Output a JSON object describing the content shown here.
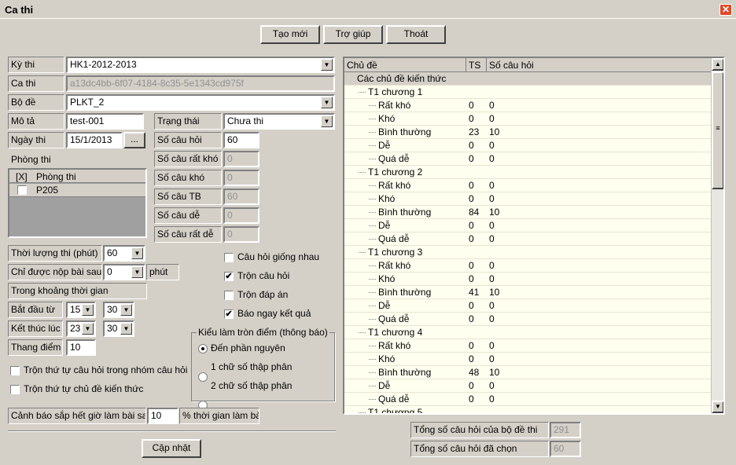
{
  "window": {
    "title": "Ca thi"
  },
  "toolbar": {
    "new_label": "Tạo mới",
    "help_label": "Trợ giúp",
    "exit_label": "Thoát"
  },
  "form": {
    "ky_thi": {
      "label": "Kỳ thi",
      "value": "HK1-2012-2013"
    },
    "ca_thi": {
      "label": "Ca thi",
      "value": "a13dc4bb-6f07-4184-8c35-5e1343cd975f"
    },
    "bo_de": {
      "label": "Bộ đề",
      "value": "PLKT_2"
    },
    "mo_ta": {
      "label": "Mô tả",
      "value": "test-001"
    },
    "trang_thai": {
      "label": "Trạng thái",
      "value": "Chưa thi"
    },
    "ngay_thi": {
      "label": "Ngày thi",
      "value": "15/1/2013",
      "picker": "..."
    },
    "so_cau_hoi": {
      "label": "Số câu hỏi",
      "value": "60"
    },
    "so_cau_rat_kho": {
      "label": "Số câu rất khó",
      "value": "0"
    },
    "so_cau_kho": {
      "label": "Số câu khó",
      "value": "0"
    },
    "so_cau_tb": {
      "label": "Số câu TB",
      "value": "60"
    },
    "so_cau_de": {
      "label": "Số câu dễ",
      "value": "0"
    },
    "so_cau_rat_de": {
      "label": "Số câu rất dễ",
      "value": "0"
    },
    "phong_thi": {
      "label": "Phòng thi",
      "col_check": "[X]",
      "col_name": "Phòng thi",
      "rooms": [
        {
          "name": "P205",
          "checked": false
        }
      ]
    },
    "thoi_luong": {
      "label": "Thời lượng thi (phút)",
      "value": "60"
    },
    "nop_bai_sau": {
      "label": "Chỉ được nộp bài sau",
      "value": "0",
      "unit": "phút"
    },
    "khoang_tg": {
      "label": "Trong khoảng thời gian"
    },
    "bat_dau": {
      "label": "Bắt đầu từ",
      "hour": "15",
      "minute": "30"
    },
    "ket_thuc": {
      "label": "Kết thúc lúc",
      "hour": "23",
      "minute": "30"
    },
    "thang_diem": {
      "label": "Thang điểm",
      "value": "10"
    },
    "tron_thu_tu_cau_hoi": {
      "label": "Trộn thứ tự câu hỏi trong nhóm câu hỏi",
      "checked": false
    },
    "tron_thu_tu_chu_de": {
      "label": "Trộn thứ tự chủ đề kiến thức",
      "checked": false
    },
    "cau_hoi_giong_nhau": {
      "label": "Câu hỏi giống nhau",
      "checked": false
    },
    "tron_cau_hoi": {
      "label": "Trộn câu hỏi",
      "checked": true
    },
    "tron_dap_an": {
      "label": "Trộn đáp án",
      "checked": false
    },
    "bao_ngay_kq": {
      "label": "Báo ngay kết quả",
      "checked": true
    },
    "lam_tron": {
      "title": "Kiểu làm tròn điểm (thông báo)",
      "options": [
        "Đến phần nguyên",
        "1 chữ số thập phân",
        "2 chữ số thập phân"
      ],
      "selected": 0
    },
    "canh_bao": {
      "label": "Cảnh báo sắp hết giờ làm bài sau",
      "value": "10",
      "unit": "% thời gian làm bài"
    },
    "update_label": "Cập nhật"
  },
  "tree": {
    "headers": [
      "Chủ đề",
      "TS",
      "Số câu hỏi"
    ],
    "rows": [
      {
        "name": "Các chủ đề kiến thức",
        "ts": "",
        "sc": "",
        "level": 0
      },
      {
        "name": "T1 chương 1",
        "ts": "",
        "sc": "",
        "level": 1
      },
      {
        "name": "Rất khó",
        "ts": "0",
        "sc": "0",
        "level": 2
      },
      {
        "name": "Khó",
        "ts": "0",
        "sc": "0",
        "level": 2
      },
      {
        "name": "Bình thường",
        "ts": "23",
        "sc": "10",
        "level": 2
      },
      {
        "name": "Dễ",
        "ts": "0",
        "sc": "0",
        "level": 2
      },
      {
        "name": "Quá dễ",
        "ts": "0",
        "sc": "0",
        "level": 2
      },
      {
        "name": "T1 chương 2",
        "ts": "",
        "sc": "",
        "level": 1
      },
      {
        "name": "Rất khó",
        "ts": "0",
        "sc": "0",
        "level": 2
      },
      {
        "name": "Khó",
        "ts": "0",
        "sc": "0",
        "level": 2
      },
      {
        "name": "Bình thường",
        "ts": "84",
        "sc": "10",
        "level": 2
      },
      {
        "name": "Dễ",
        "ts": "0",
        "sc": "0",
        "level": 2
      },
      {
        "name": "Quá dễ",
        "ts": "0",
        "sc": "0",
        "level": 2
      },
      {
        "name": "T1 chương 3",
        "ts": "",
        "sc": "",
        "level": 1
      },
      {
        "name": "Rất khó",
        "ts": "0",
        "sc": "0",
        "level": 2
      },
      {
        "name": "Khó",
        "ts": "0",
        "sc": "0",
        "level": 2
      },
      {
        "name": "Bình thường",
        "ts": "41",
        "sc": "10",
        "level": 2
      },
      {
        "name": "Dễ",
        "ts": "0",
        "sc": "0",
        "level": 2
      },
      {
        "name": "Quá dễ",
        "ts": "0",
        "sc": "0",
        "level": 2
      },
      {
        "name": "T1 chương 4",
        "ts": "",
        "sc": "",
        "level": 1
      },
      {
        "name": "Rất khó",
        "ts": "0",
        "sc": "0",
        "level": 2
      },
      {
        "name": "Khó",
        "ts": "0",
        "sc": "0",
        "level": 2
      },
      {
        "name": "Bình thường",
        "ts": "48",
        "sc": "10",
        "level": 2
      },
      {
        "name": "Dễ",
        "ts": "0",
        "sc": "0",
        "level": 2
      },
      {
        "name": "Quá dễ",
        "ts": "0",
        "sc": "0",
        "level": 2
      },
      {
        "name": "T1 chương 5",
        "ts": "",
        "sc": "",
        "level": 1
      }
    ]
  },
  "totals": {
    "bo_de": {
      "label": "Tổng số câu hỏi của bộ đề thi",
      "value": "291"
    },
    "da_chon": {
      "label": "Tổng số câu hỏi đã chọn",
      "value": "60"
    }
  }
}
